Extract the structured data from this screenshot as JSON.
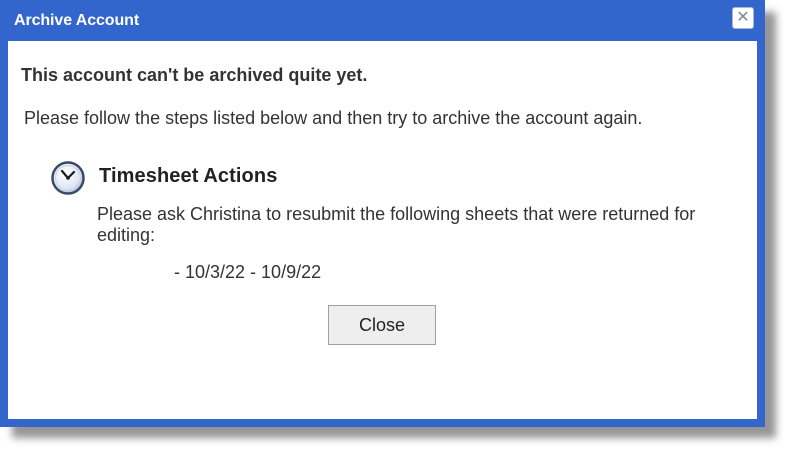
{
  "dialog": {
    "title": "Archive Account",
    "close_icon": "close-icon",
    "colors": {
      "frame": "#3366cc",
      "content_bg": "#ffffff",
      "text": "#333333"
    }
  },
  "message": {
    "heading": "This account can't be archived quite yet.",
    "instruction": "Please follow the steps listed below and then try to archive the account again."
  },
  "timesheet_section": {
    "icon": "clock-icon",
    "title": "Timesheet Actions",
    "body": "Please ask Christina to resubmit the following sheets that were returned for editing:",
    "items": [
      "- 10/3/22 - 10/9/22"
    ]
  },
  "actions": {
    "close_label": "Close"
  }
}
